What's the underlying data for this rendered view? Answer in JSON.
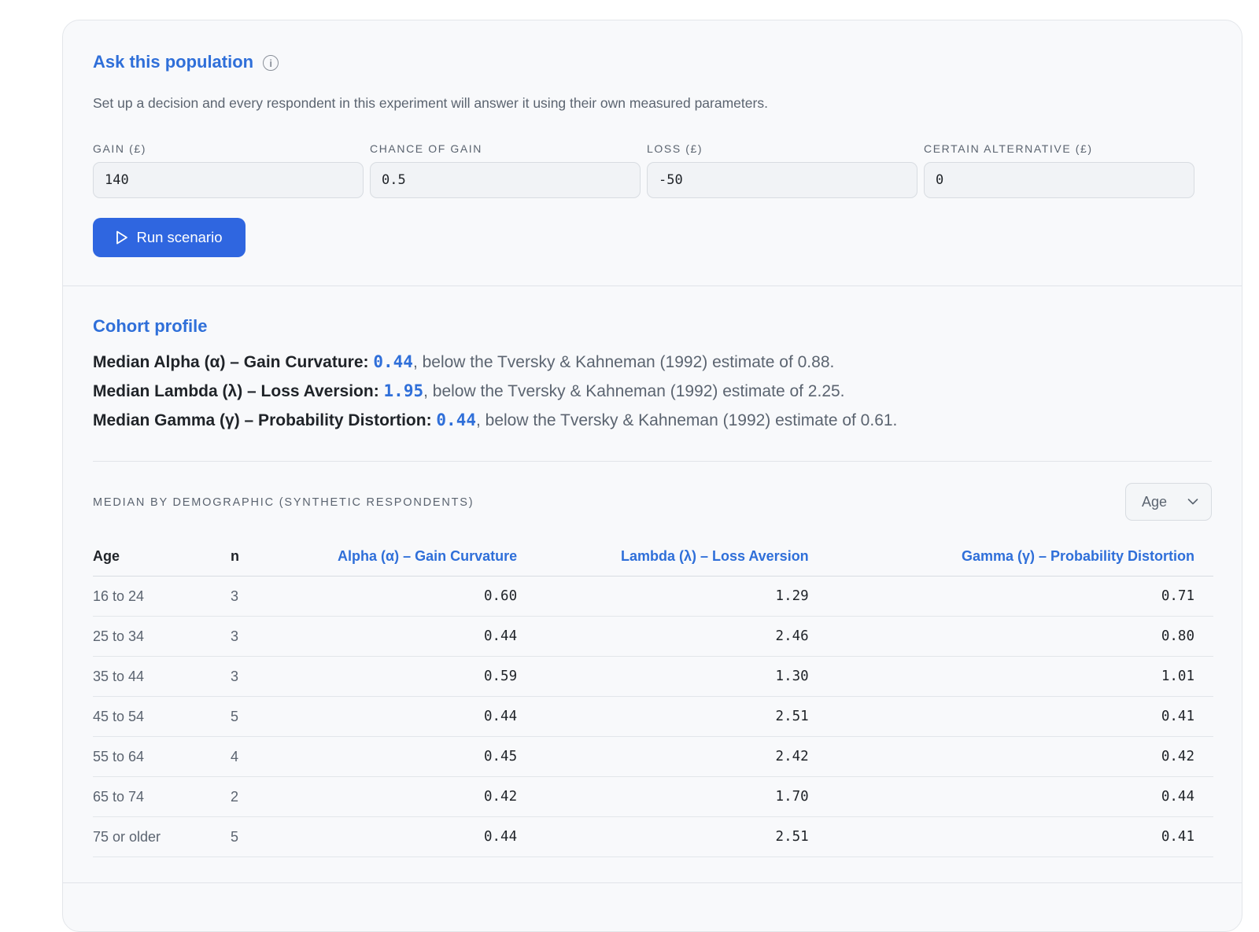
{
  "ask": {
    "title": "Ask this population",
    "info_icon": "info-circle-icon",
    "description": "Set up a decision and every respondent in this experiment will answer it using their own measured parameters.",
    "fields": [
      {
        "label": "GAIN (£)",
        "value": "140"
      },
      {
        "label": "CHANCE OF GAIN",
        "value": "0.5"
      },
      {
        "label": "LOSS (£)",
        "value": "-50"
      },
      {
        "label": "CERTAIN ALTERNATIVE (£)",
        "value": "0"
      }
    ],
    "run_button": "Run scenario",
    "run_icon": "play-icon"
  },
  "cohort": {
    "title": "Cohort profile",
    "stats": [
      {
        "label": "Median Alpha (α) – Gain Curvature:",
        "value": "0.44",
        "suffix": ", below the Tversky & Kahneman (1992) estimate of 0.88."
      },
      {
        "label": "Median Lambda (λ) – Loss Aversion:",
        "value": "1.95",
        "suffix": ", below the Tversky & Kahneman (1992) estimate of 2.25."
      },
      {
        "label": "Median Gamma (γ) – Probability Distortion:",
        "value": "0.44",
        "suffix": ", below the Tversky & Kahneman (1992) estimate of 0.61."
      }
    ],
    "demographic_label": "MEDIAN BY DEMOGRAPHIC (SYNTHETIC RESPONDENTS)",
    "select_value": "Age",
    "table": {
      "headers": [
        "Age",
        "n",
        "Alpha (α) – Gain Curvature",
        "Lambda (λ) – Loss Aversion",
        "Gamma (γ) – Probability Distortion"
      ],
      "rows": [
        [
          "16 to 24",
          "3",
          "0.60",
          "1.29",
          "0.71"
        ],
        [
          "25 to 34",
          "3",
          "0.44",
          "2.46",
          "0.80"
        ],
        [
          "35 to 44",
          "3",
          "0.59",
          "1.30",
          "1.01"
        ],
        [
          "45 to 54",
          "5",
          "0.44",
          "2.51",
          "0.41"
        ],
        [
          "55 to 64",
          "4",
          "0.45",
          "2.42",
          "0.42"
        ],
        [
          "65 to 74",
          "2",
          "0.42",
          "1.70",
          "0.44"
        ],
        [
          "75 or older",
          "5",
          "0.44",
          "2.51",
          "0.41"
        ]
      ]
    }
  }
}
